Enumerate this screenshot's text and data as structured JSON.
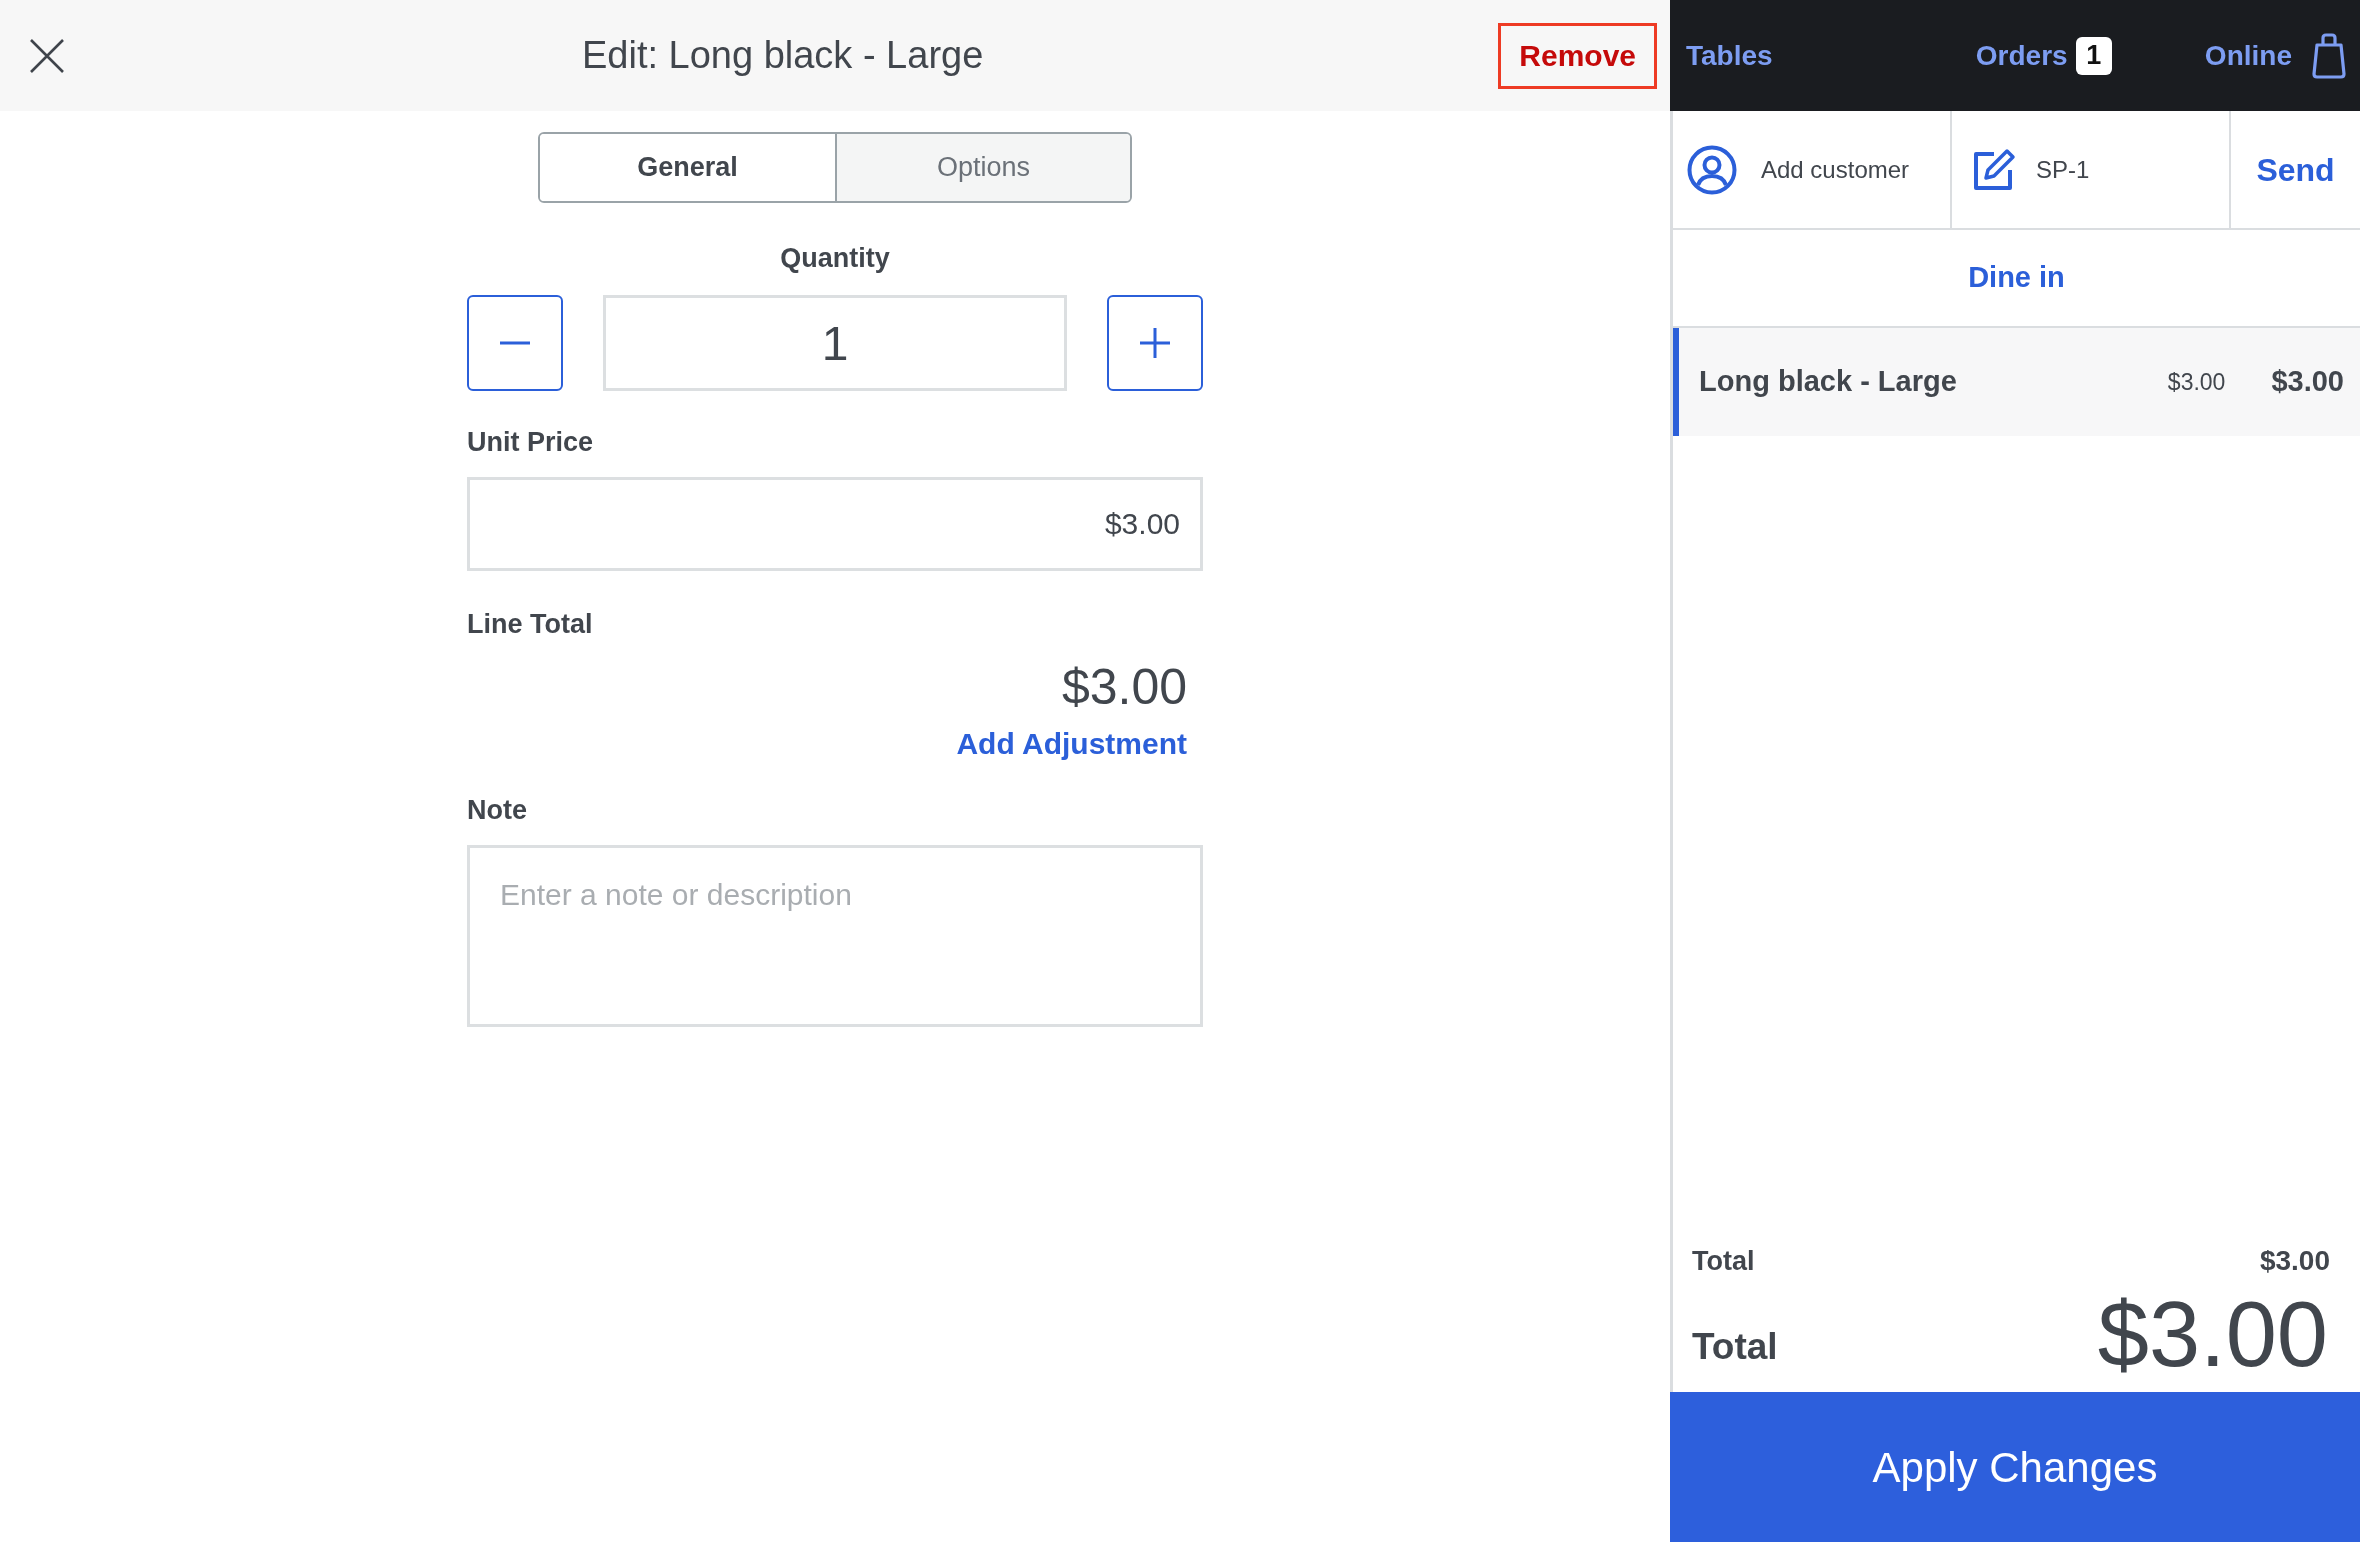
{
  "header": {
    "title": "Edit: Long black - Large",
    "remove_label": "Remove"
  },
  "tabs": [
    {
      "label": "General",
      "selected": true
    },
    {
      "label": "Options",
      "selected": false
    }
  ],
  "quantity": {
    "label": "Quantity",
    "value": "1"
  },
  "unit_price": {
    "label": "Unit Price",
    "value": "$3.00"
  },
  "line_total": {
    "label": "Line Total",
    "value": "$3.00",
    "action": "Add Adjustment"
  },
  "note": {
    "label": "Note",
    "placeholder": "Enter a note or description"
  },
  "nav": [
    {
      "kind": "plain",
      "label": "Tables"
    },
    {
      "kind": "count",
      "label": "Orders",
      "badge": "1"
    },
    {
      "kind": "bag",
      "label": "Online"
    }
  ],
  "order_bar": {
    "customer": "Add customer",
    "order_name": "SP-1",
    "send": "Send"
  },
  "order_type": "Dine in",
  "lines": [
    {
      "name": "Long black - Large",
      "unit_price": "$3.00",
      "total": "$3.00",
      "selected": true
    }
  ],
  "summary": [
    {
      "label": "Total",
      "value": "$3.00"
    }
  ],
  "grand_total": {
    "label": "Total",
    "value": "$3.00"
  },
  "apply_label": "Apply Changes"
}
